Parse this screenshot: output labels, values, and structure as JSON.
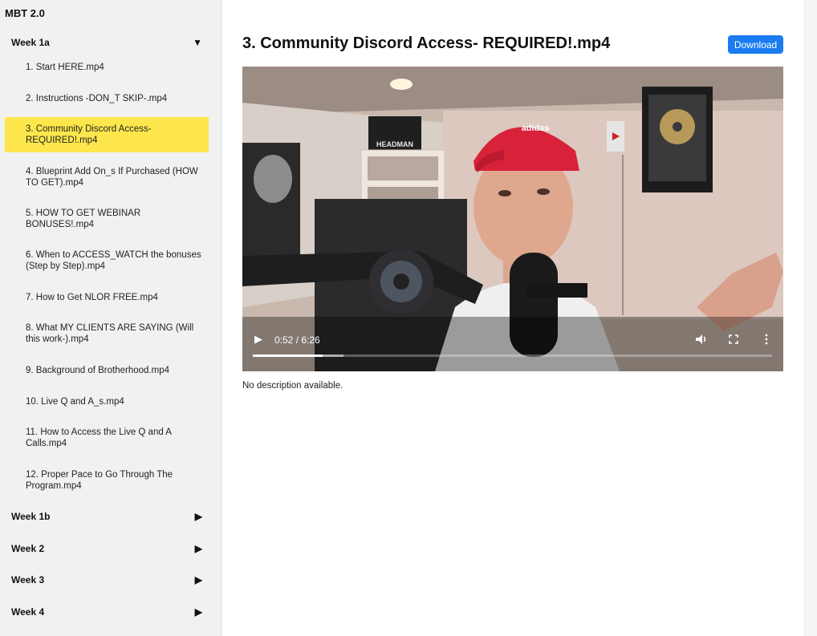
{
  "sidebar": {
    "app_title": "MBT 2.0",
    "weeks": [
      {
        "label": "Week 1a",
        "state": "expanded"
      },
      {
        "label": "Week 1b",
        "state": "collapsed"
      },
      {
        "label": "Week 2",
        "state": "collapsed"
      },
      {
        "label": "Week 3",
        "state": "collapsed"
      },
      {
        "label": "Week 4",
        "state": "collapsed"
      }
    ],
    "lessons": [
      "1. Start HERE.mp4",
      "2. Instructions -DON_T SKIP-.mp4",
      "3. Community Discord Access- REQUIRED!.mp4",
      "4. Blueprint Add On_s If Purchased (HOW TO GET).mp4",
      "5. HOW TO GET WEBINAR BONUSES!.mp4",
      "6. When to ACCESS_WATCH the bonuses (Step by Step).mp4",
      "7. How to Get NLOR FREE.mp4",
      "8. What MY CLIENTS ARE SAYING (Will this work-).mp4",
      "9. Background of Brotherhood.mp4",
      "10. Live Q and A_s.mp4",
      "11. How to Access the Live Q and A Calls.mp4",
      "12. Proper Pace to Go Through The Program.mp4"
    ],
    "active_lesson_index": 2
  },
  "main": {
    "title": "3. Community Discord Access- REQUIRED!.mp4",
    "download_label": "Download",
    "description": "No description available."
  },
  "player": {
    "current_time": "0:52",
    "duration": "6:26",
    "time_display": "0:52 / 6:26",
    "progress_fraction": 0.135,
    "buffered_fraction": 0.175,
    "icons": [
      "play-icon",
      "volume-icon",
      "fullscreen-icon",
      "more-options-icon"
    ],
    "scene": {
      "poster_banner_text": "HEADMAN",
      "cap_logo_text": "adidas"
    }
  },
  "colors": {
    "active_item": "#fde74c",
    "download_button": "#1a7cf0",
    "sidebar_bg": "#f1f1f1"
  }
}
